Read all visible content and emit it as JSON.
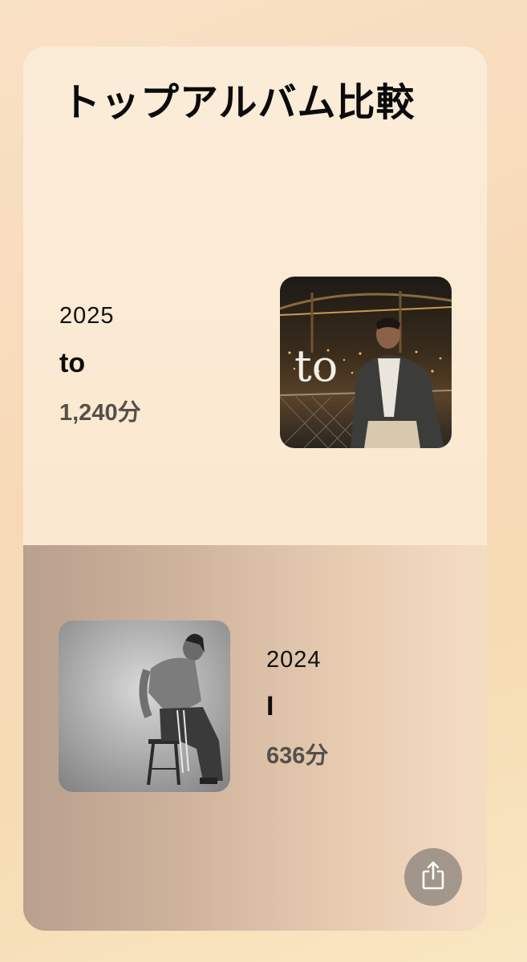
{
  "title": "トップアルバム比較",
  "albums": [
    {
      "year": "2025",
      "name": "to",
      "minutes": "1,240分",
      "cover_text": "to"
    },
    {
      "year": "2024",
      "name": "I",
      "minutes": "636分"
    }
  ],
  "icons": {
    "share": "share-icon"
  },
  "colors": {
    "background": "#f8dfc0",
    "card_top": "#fbecd8",
    "card_bottom_left": "#b9a08d",
    "card_bottom_right": "#f4dcc3",
    "share_button": "#918780"
  }
}
